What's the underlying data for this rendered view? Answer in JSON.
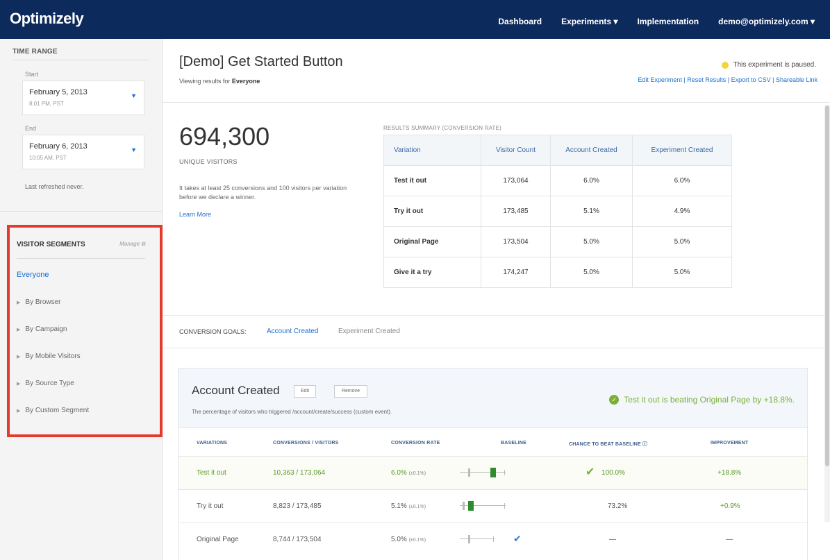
{
  "app": {
    "logo": "Optimizely"
  },
  "nav": {
    "dashboard": "Dashboard",
    "experiments": "Experiments ▾",
    "implementation": "Implementation",
    "account": "demo@optimizely.com ▾"
  },
  "sidebar": {
    "time_range_title": "TIME RANGE",
    "start_label": "Start",
    "start_date": "February 5, 2013",
    "start_time": "8:01 PM, PST",
    "end_label": "End",
    "end_date": "February 6, 2013",
    "end_time": "10:05 AM, PST",
    "refreshed": "Last refreshed never.",
    "segments_title": "VISITOR SEGMENTS",
    "manage_label": "Manage ⧉",
    "everyone": "Everyone",
    "items": [
      "By Browser",
      "By Campaign",
      "By Mobile Visitors",
      "By Source Type",
      "By Custom Segment"
    ]
  },
  "header": {
    "title": "[Demo] Get Started Button",
    "viewing_prefix": "Viewing results for ",
    "viewing_segment": "Everyone",
    "status": "This experiment is paused.",
    "status_color": "#f2d43c",
    "links": "Edit Experiment | Reset Results | Export to CSV | Shareable Link"
  },
  "summary": {
    "visitors": "694,300",
    "visitors_label": "UNIQUE VISITORS",
    "note": "It takes at least 25 conversions and 100 visitors per variation before we declare a winner.",
    "learn_more": "Learn More",
    "caption": "RESULTS SUMMARY (CONVERSION RATE)",
    "headers": [
      "Variation",
      "Visitor Count",
      "Account Created",
      "Experiment Created"
    ],
    "rows": [
      [
        "Test it out",
        "173,064",
        "6.0%",
        "6.0%"
      ],
      [
        "Try it out",
        "173,485",
        "5.1%",
        "4.9%"
      ],
      [
        "Original Page",
        "173,504",
        "5.0%",
        "5.0%"
      ],
      [
        "Give it a try",
        "174,247",
        "5.0%",
        "5.0%"
      ]
    ]
  },
  "goals": {
    "label": "CONVERSION GOALS:",
    "active": "Account Created",
    "other": "Experiment Created"
  },
  "card": {
    "title": "Account Created",
    "edit": "Edit",
    "remove": "Remove",
    "description": "The percentage of visitors who triggered /account/create/success (custom event).",
    "beating": "Test it out is beating Original Page by +18.8%.",
    "accent": "#7bb036",
    "headers": [
      "VARIATIONS",
      "CONVERSIONS / VISITORS",
      "CONVERSION RATE",
      "BASELINE",
      "CHANCE TO BEAT BASELINE ⓘ",
      "IMPROVEMENT"
    ],
    "rows": [
      {
        "name": "Test it out",
        "conv": "10,363 / 173,064",
        "rate": "6.0%",
        "ci": "(±0.1%)",
        "chance": "100.0%",
        "improvement": "+18.8%"
      },
      {
        "name": "Try it out",
        "conv": "8,823 / 173,485",
        "rate": "5.1%",
        "ci": "(±0.1%)",
        "chance": "73.2%",
        "improvement": "+0.9%"
      },
      {
        "name": "Original Page",
        "conv": "8,744 / 173,504",
        "rate": "5.0%",
        "ci": "(±0.1%)",
        "chance": "—",
        "improvement": "—"
      }
    ]
  }
}
